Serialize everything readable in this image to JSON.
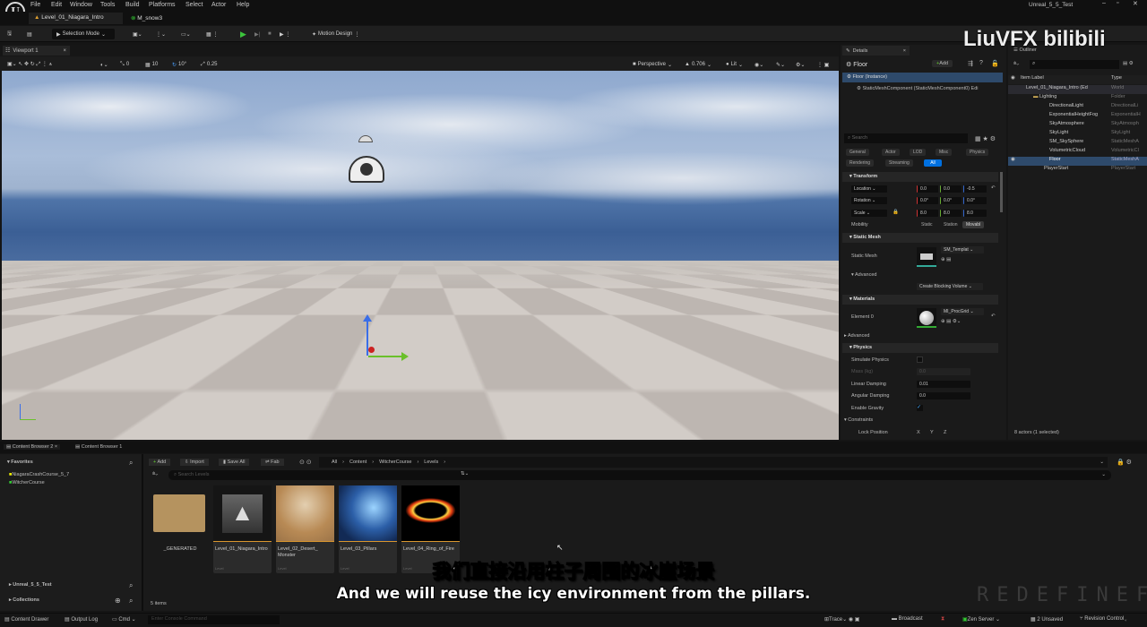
{
  "app": {
    "project_title": "Unreal_5_5_Test",
    "logo_text": "U"
  },
  "menu": [
    "File",
    "Edit",
    "Window",
    "Tools",
    "Build",
    "Platforms",
    "Select",
    "Actor",
    "Help"
  ],
  "doc_tabs": [
    {
      "label": "Level_01_Niagara_Intro"
    },
    {
      "label": "M_snow3"
    }
  ],
  "toolbar": {
    "selection_mode": "Selection Mode",
    "motion_design": "Motion Design"
  },
  "viewport": {
    "tab": "Viewport 1",
    "snap_translate": "0",
    "snap_grid": "10",
    "snap_rotate": "10°",
    "snap_scale": "0.25",
    "perspective": "Perspective",
    "fov": "0.706",
    "view_mode": "Lit"
  },
  "details": {
    "tab": "Details",
    "object": "Floor",
    "add": "Add",
    "instance": "Floor (Instance)",
    "component": "StaticMeshComponent (StaticMeshComponent0)",
    "component_suffix": "Edi",
    "search_placeholder": "Search",
    "filters": [
      "General",
      "Actor",
      "LOD",
      "Misc",
      "Physics",
      "Rendering",
      "Streaming",
      "All"
    ],
    "transform": {
      "title": "Transform",
      "location_label": "Location",
      "location": [
        "0.0",
        "0.0",
        "-0.5"
      ],
      "rotation_label": "Rotation",
      "rotation": [
        "0.0°",
        "0.0°",
        "0.0°"
      ],
      "scale_label": "Scale",
      "scale": [
        "8.0",
        "8.0",
        "8.0"
      ],
      "mobility_label": "Mobility",
      "mobility": [
        "Static",
        "Station",
        "Movabl"
      ]
    },
    "static_mesh": {
      "title": "Static Mesh",
      "label": "Static Mesh",
      "value": "SM_Templat",
      "advanced": "Advanced",
      "blocking": "Create Blocking Volume"
    },
    "materials": {
      "title": "Materials",
      "element": "Element 0",
      "value": "MI_ProcGrid",
      "advanced": "Advanced"
    },
    "physics": {
      "title": "Physics",
      "simulate": "Simulate Physics",
      "mass_label": "Mass (kg)",
      "mass_value": "0.0",
      "linear_label": "Linear Damping",
      "linear": "0.01",
      "angular_label": "Angular Damping",
      "angular": "0.0",
      "gravity": "Enable Gravity",
      "constraints": "Constraints",
      "lock_position": "Lock Position",
      "axes": [
        "X",
        "Y",
        "Z"
      ]
    }
  },
  "outliner": {
    "tab": "Outliner",
    "col_label": "Item Label",
    "col_type": "Type",
    "footer": "8 actors (1 selected)",
    "items": [
      {
        "label": "Level_01_Niagara_Intro (Ed",
        "type": "World"
      },
      {
        "label": "Lighting",
        "type": "Folder"
      },
      {
        "label": "DirectionalLight",
        "type": "DirectionalLi"
      },
      {
        "label": "ExponentialHeightFog",
        "type": "ExponentialH"
      },
      {
        "label": "SkyAtmosphere",
        "type": "SkyAtmosph"
      },
      {
        "label": "SkyLight",
        "type": "SkyLight"
      },
      {
        "label": "SM_SkySphere",
        "type": "StaticMeshA"
      },
      {
        "label": "VolumetricCloud",
        "type": "VolumetricCl"
      },
      {
        "label": "Floor",
        "type": "StaticMeshA"
      },
      {
        "label": "PlayerStart",
        "type": "PlayerStart"
      }
    ]
  },
  "content_browser": {
    "tabs": [
      "Content Browser 2",
      "Content Browser 1"
    ],
    "favorites": "Favorites",
    "fav_items": [
      "NiagaraCrashCourse_5_7",
      "WitcherCourse"
    ],
    "project": "Unreal_5_5_Test",
    "collections": "Collections",
    "add": "Add",
    "import": "Import",
    "save_all": "Save All",
    "fab": "Fab",
    "breadcrumb": [
      "All",
      "Content",
      "WitcherCourse",
      "Levels"
    ],
    "search_placeholder": "Search Levels",
    "count": "5 items",
    "assets": [
      {
        "name": "_GENERATED",
        "type": ""
      },
      {
        "name": "Level_01_Niagara_Intro",
        "type": "Level"
      },
      {
        "name": "Level_02_Desert_ Monster",
        "type": "Level"
      },
      {
        "name": "Level_03_Pillars",
        "type": "Level"
      },
      {
        "name": "Level_04_Ring_of_Fire",
        "type": "Level"
      }
    ]
  },
  "statusbar": {
    "content_drawer": "Content Drawer",
    "output_log": "Output Log",
    "cmd": "Cmd",
    "cmd_placeholder": "Enter Console Command",
    "trace": "Trace",
    "broadcast": "Broadcast",
    "zen": "Zen Server",
    "unsaved": "2 Unsaved",
    "revision": "Revision Control"
  },
  "subtitles": {
    "cn": "我们直接沿用柱子周围的冰崖场景",
    "en": "And we will reuse the icy environment from the pillars."
  },
  "watermarks": {
    "top": "LiuVFX bilibili",
    "bottom": "REDEFINEFX"
  },
  "colors": {
    "accent": "#0070e0",
    "play": "#3cc43c",
    "selection": "#2e4a6b"
  }
}
